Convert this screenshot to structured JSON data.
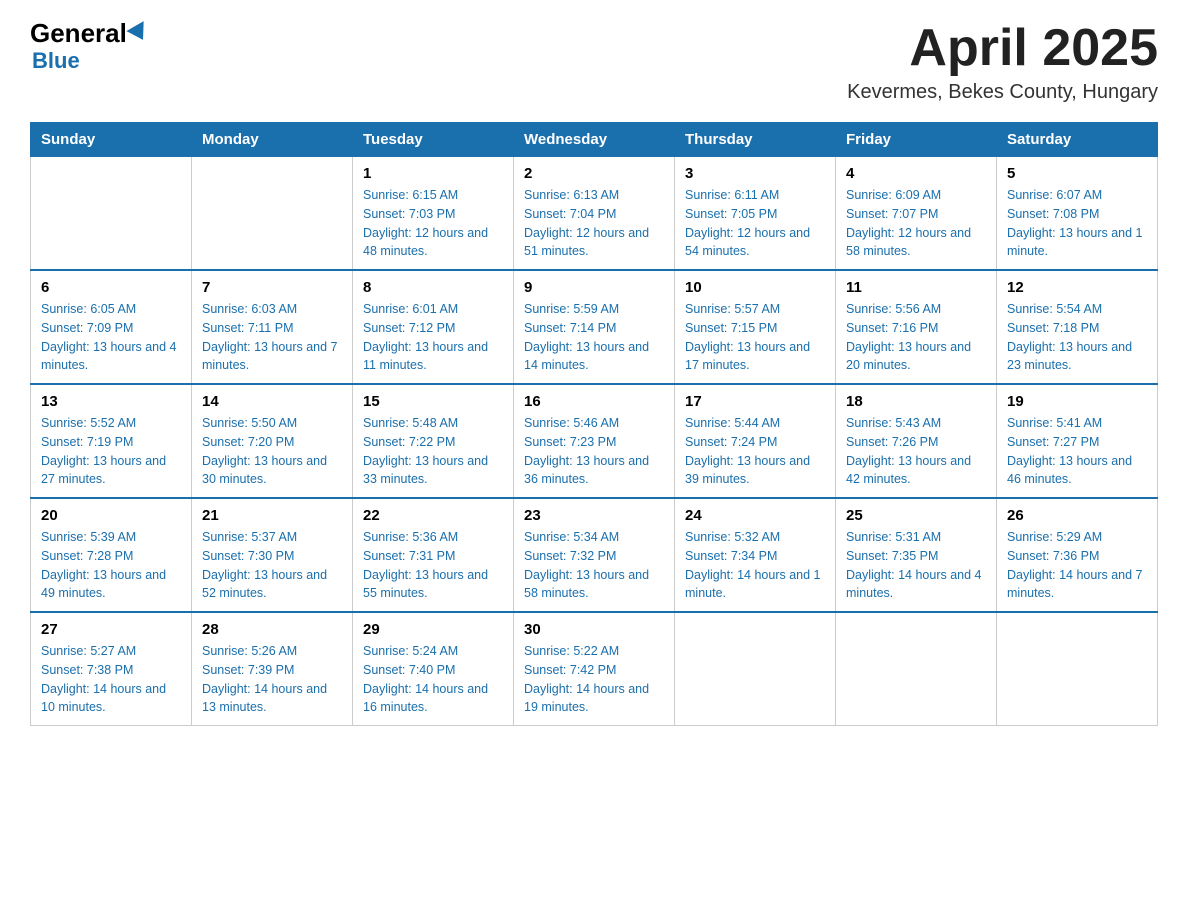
{
  "logo": {
    "general": "General",
    "triangle": "",
    "blue": "Blue"
  },
  "header": {
    "title": "April 2025",
    "subtitle": "Kevermes, Bekes County, Hungary"
  },
  "weekdays": [
    "Sunday",
    "Monday",
    "Tuesday",
    "Wednesday",
    "Thursday",
    "Friday",
    "Saturday"
  ],
  "weeks": [
    [
      {
        "day": "",
        "sunrise": "",
        "sunset": "",
        "daylight": ""
      },
      {
        "day": "",
        "sunrise": "",
        "sunset": "",
        "daylight": ""
      },
      {
        "day": "1",
        "sunrise": "Sunrise: 6:15 AM",
        "sunset": "Sunset: 7:03 PM",
        "daylight": "Daylight: 12 hours and 48 minutes."
      },
      {
        "day": "2",
        "sunrise": "Sunrise: 6:13 AM",
        "sunset": "Sunset: 7:04 PM",
        "daylight": "Daylight: 12 hours and 51 minutes."
      },
      {
        "day": "3",
        "sunrise": "Sunrise: 6:11 AM",
        "sunset": "Sunset: 7:05 PM",
        "daylight": "Daylight: 12 hours and 54 minutes."
      },
      {
        "day": "4",
        "sunrise": "Sunrise: 6:09 AM",
        "sunset": "Sunset: 7:07 PM",
        "daylight": "Daylight: 12 hours and 58 minutes."
      },
      {
        "day": "5",
        "sunrise": "Sunrise: 6:07 AM",
        "sunset": "Sunset: 7:08 PM",
        "daylight": "Daylight: 13 hours and 1 minute."
      }
    ],
    [
      {
        "day": "6",
        "sunrise": "Sunrise: 6:05 AM",
        "sunset": "Sunset: 7:09 PM",
        "daylight": "Daylight: 13 hours and 4 minutes."
      },
      {
        "day": "7",
        "sunrise": "Sunrise: 6:03 AM",
        "sunset": "Sunset: 7:11 PM",
        "daylight": "Daylight: 13 hours and 7 minutes."
      },
      {
        "day": "8",
        "sunrise": "Sunrise: 6:01 AM",
        "sunset": "Sunset: 7:12 PM",
        "daylight": "Daylight: 13 hours and 11 minutes."
      },
      {
        "day": "9",
        "sunrise": "Sunrise: 5:59 AM",
        "sunset": "Sunset: 7:14 PM",
        "daylight": "Daylight: 13 hours and 14 minutes."
      },
      {
        "day": "10",
        "sunrise": "Sunrise: 5:57 AM",
        "sunset": "Sunset: 7:15 PM",
        "daylight": "Daylight: 13 hours and 17 minutes."
      },
      {
        "day": "11",
        "sunrise": "Sunrise: 5:56 AM",
        "sunset": "Sunset: 7:16 PM",
        "daylight": "Daylight: 13 hours and 20 minutes."
      },
      {
        "day": "12",
        "sunrise": "Sunrise: 5:54 AM",
        "sunset": "Sunset: 7:18 PM",
        "daylight": "Daylight: 13 hours and 23 minutes."
      }
    ],
    [
      {
        "day": "13",
        "sunrise": "Sunrise: 5:52 AM",
        "sunset": "Sunset: 7:19 PM",
        "daylight": "Daylight: 13 hours and 27 minutes."
      },
      {
        "day": "14",
        "sunrise": "Sunrise: 5:50 AM",
        "sunset": "Sunset: 7:20 PM",
        "daylight": "Daylight: 13 hours and 30 minutes."
      },
      {
        "day": "15",
        "sunrise": "Sunrise: 5:48 AM",
        "sunset": "Sunset: 7:22 PM",
        "daylight": "Daylight: 13 hours and 33 minutes."
      },
      {
        "day": "16",
        "sunrise": "Sunrise: 5:46 AM",
        "sunset": "Sunset: 7:23 PM",
        "daylight": "Daylight: 13 hours and 36 minutes."
      },
      {
        "day": "17",
        "sunrise": "Sunrise: 5:44 AM",
        "sunset": "Sunset: 7:24 PM",
        "daylight": "Daylight: 13 hours and 39 minutes."
      },
      {
        "day": "18",
        "sunrise": "Sunrise: 5:43 AM",
        "sunset": "Sunset: 7:26 PM",
        "daylight": "Daylight: 13 hours and 42 minutes."
      },
      {
        "day": "19",
        "sunrise": "Sunrise: 5:41 AM",
        "sunset": "Sunset: 7:27 PM",
        "daylight": "Daylight: 13 hours and 46 minutes."
      }
    ],
    [
      {
        "day": "20",
        "sunrise": "Sunrise: 5:39 AM",
        "sunset": "Sunset: 7:28 PM",
        "daylight": "Daylight: 13 hours and 49 minutes."
      },
      {
        "day": "21",
        "sunrise": "Sunrise: 5:37 AM",
        "sunset": "Sunset: 7:30 PM",
        "daylight": "Daylight: 13 hours and 52 minutes."
      },
      {
        "day": "22",
        "sunrise": "Sunrise: 5:36 AM",
        "sunset": "Sunset: 7:31 PM",
        "daylight": "Daylight: 13 hours and 55 minutes."
      },
      {
        "day": "23",
        "sunrise": "Sunrise: 5:34 AM",
        "sunset": "Sunset: 7:32 PM",
        "daylight": "Daylight: 13 hours and 58 minutes."
      },
      {
        "day": "24",
        "sunrise": "Sunrise: 5:32 AM",
        "sunset": "Sunset: 7:34 PM",
        "daylight": "Daylight: 14 hours and 1 minute."
      },
      {
        "day": "25",
        "sunrise": "Sunrise: 5:31 AM",
        "sunset": "Sunset: 7:35 PM",
        "daylight": "Daylight: 14 hours and 4 minutes."
      },
      {
        "day": "26",
        "sunrise": "Sunrise: 5:29 AM",
        "sunset": "Sunset: 7:36 PM",
        "daylight": "Daylight: 14 hours and 7 minutes."
      }
    ],
    [
      {
        "day": "27",
        "sunrise": "Sunrise: 5:27 AM",
        "sunset": "Sunset: 7:38 PM",
        "daylight": "Daylight: 14 hours and 10 minutes."
      },
      {
        "day": "28",
        "sunrise": "Sunrise: 5:26 AM",
        "sunset": "Sunset: 7:39 PM",
        "daylight": "Daylight: 14 hours and 13 minutes."
      },
      {
        "day": "29",
        "sunrise": "Sunrise: 5:24 AM",
        "sunset": "Sunset: 7:40 PM",
        "daylight": "Daylight: 14 hours and 16 minutes."
      },
      {
        "day": "30",
        "sunrise": "Sunrise: 5:22 AM",
        "sunset": "Sunset: 7:42 PM",
        "daylight": "Daylight: 14 hours and 19 minutes."
      },
      {
        "day": "",
        "sunrise": "",
        "sunset": "",
        "daylight": ""
      },
      {
        "day": "",
        "sunrise": "",
        "sunset": "",
        "daylight": ""
      },
      {
        "day": "",
        "sunrise": "",
        "sunset": "",
        "daylight": ""
      }
    ]
  ]
}
